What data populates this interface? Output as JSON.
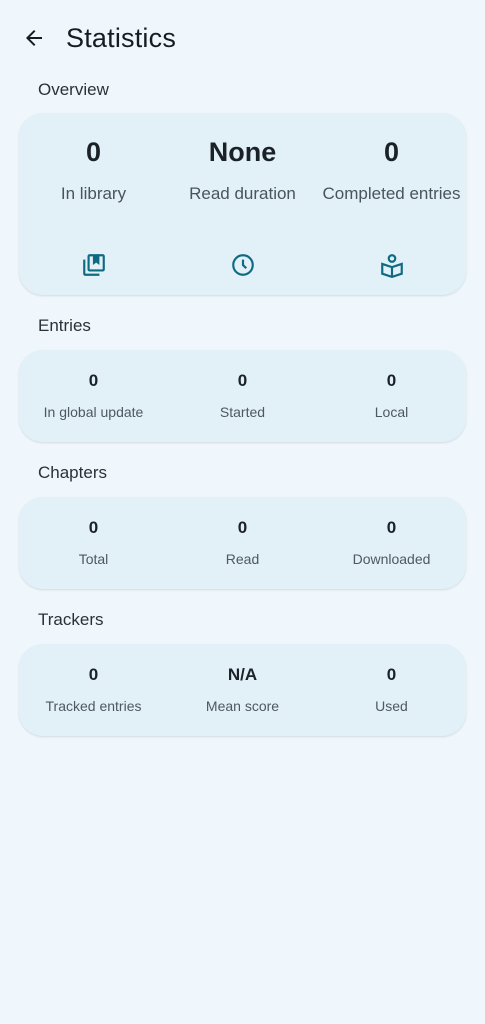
{
  "header": {
    "title": "Statistics"
  },
  "overview": {
    "title": "Overview",
    "stats": [
      {
        "value": "0",
        "label": "In library",
        "icon": "library-icon"
      },
      {
        "value": "None",
        "label": "Read duration",
        "icon": "clock-icon"
      },
      {
        "value": "0",
        "label": "Completed entries",
        "icon": "book-reader-icon"
      }
    ]
  },
  "entries": {
    "title": "Entries",
    "stats": [
      {
        "value": "0",
        "label": "In global update"
      },
      {
        "value": "0",
        "label": "Started"
      },
      {
        "value": "0",
        "label": "Local"
      }
    ]
  },
  "chapters": {
    "title": "Chapters",
    "stats": [
      {
        "value": "0",
        "label": "Total"
      },
      {
        "value": "0",
        "label": "Read"
      },
      {
        "value": "0",
        "label": "Downloaded"
      }
    ]
  },
  "trackers": {
    "title": "Trackers",
    "stats": [
      {
        "value": "0",
        "label": "Tracked entries"
      },
      {
        "value": "N/A",
        "label": "Mean score"
      },
      {
        "value": "0",
        "label": "Used"
      }
    ]
  },
  "colors": {
    "accent": "#0f6b82",
    "background": "#eff7fc",
    "card": "#e2f0f8"
  }
}
